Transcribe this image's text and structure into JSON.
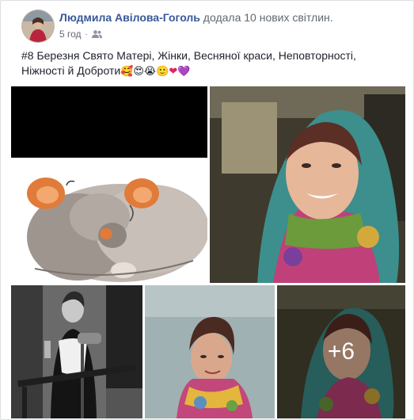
{
  "post": {
    "author_name": "Людмила Авілова-Гоголь",
    "action": "додала 10 нових світлин.",
    "time": "5 год",
    "separator": "·",
    "privacy_icon": "friends-icon",
    "text_line1": "#8 Березня Свято Матері, Жінки, Весняної краси, Неповторності,",
    "text_line2": "Ніжності й Доброти",
    "emojis": [
      "🥰",
      "😍",
      "😭",
      "🙂",
      "❤",
      "💜"
    ]
  },
  "photos": {
    "items": [
      {
        "name": "photo-mice-illustration"
      },
      {
        "name": "photo-woman-scarf-selfie"
      },
      {
        "name": "photo-woman-microphone"
      },
      {
        "name": "photo-woman-portrait"
      },
      {
        "name": "photo-woman-scarf-more"
      }
    ],
    "more_count": "+6"
  },
  "colors": {
    "link": "#385898",
    "text": "#1d2129",
    "secondary": "#606770",
    "background": "#e9ebee",
    "card": "#ffffff"
  }
}
